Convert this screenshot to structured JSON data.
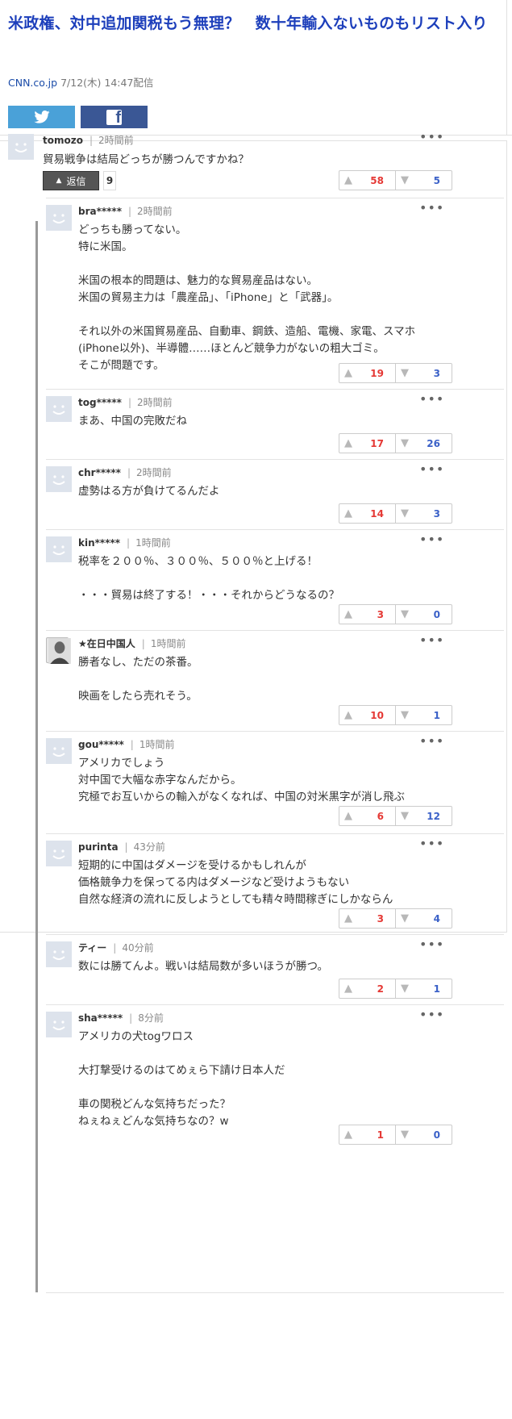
{
  "article": {
    "title": "米政権、対中追加関税もう無理？　数十年輸入ないものもリスト入り",
    "source": "CNN.co.jp",
    "date": "7/12(木) 14:47配信"
  },
  "share": {
    "twitter_icon": "twitter-bird-icon",
    "facebook_icon": "facebook-f-icon",
    "facebook_glyph": "f"
  },
  "top_comment": {
    "user": "tomozo",
    "time": "2時間前",
    "text": "貿易戦争は結局どっちが勝つんですかね？",
    "likes": "58",
    "dislikes": "5",
    "reply_label": "返信",
    "reply_count": "9",
    "more": "•••"
  },
  "replies": [
    {
      "user": "bra*****",
      "time": "2時間前",
      "text": "どっちも勝ってない。\n特に米国。\n\n米国の根本的問題は、魅力的な貿易産品はない。\n米国の貿易主力は「農産品」、「iPhone」と「武器」。\n\nそれ以外の米国貿易産品、自動車、鋼鉄、造船、電機、家電、スマホ(iPhone以外)、半導體……ほとんど競争力がないの粗大ゴミ。\nそこが問題です。",
      "likes": "19",
      "dislikes": "3"
    },
    {
      "user": "tog*****",
      "time": "2時間前",
      "text": "まあ、中国の完敗だね",
      "likes": "17",
      "dislikes": "26"
    },
    {
      "user": "chr*****",
      "time": "2時間前",
      "text": "虚勢はる方が負けてるんだよ",
      "likes": "14",
      "dislikes": "3"
    },
    {
      "user": "kin*****",
      "time": "1時間前",
      "text": "税率を２００％、３００％、５００％と上げる！\n\n・・・貿易は終了する！・・・それからどうなるの？",
      "likes": "3",
      "dislikes": "0"
    },
    {
      "user": "★在日中国人",
      "time": "1時間前",
      "text": "勝者なし、ただの茶番。\n\n映画をしたら売れそう。",
      "likes": "10",
      "dislikes": "1"
    },
    {
      "user": "gou*****",
      "time": "1時間前",
      "text": "アメリカでしょう\n対中国で大幅な赤字なんだから。\n究極でお互いからの輸入がなくなれば、中国の対米黒字が消し飛ぶ",
      "likes": "6",
      "dislikes": "12"
    },
    {
      "user": "purinta",
      "time": "43分前",
      "text": "短期的に中国はダメージを受けるかもしれんが\n価格競争力を保ってる内はダメージなど受けようもない\n自然な経済の流れに反しようとしても精々時間稼ぎにしかならん",
      "likes": "3",
      "dislikes": "4"
    },
    {
      "user": "ティー",
      "time": "40分前",
      "text": "数には勝てんよ。戦いは結局数が多いほうが勝つ。",
      "likes": "2",
      "dislikes": "1"
    },
    {
      "user": "sha*****",
      "time": "8分前",
      "text": "アメリカの犬togワロス\n\n大打撃受けるのはてめぇら下請け日本人だ\n\n車の関税どんな気持ちだった？\nねぇねぇどんな気持ちなの？w",
      "likes": "1",
      "dislikes": "0"
    }
  ],
  "icons": {
    "like": "thumbs-up-icon",
    "dislike": "thumbs-down-icon",
    "avatar": "default-avatar-icon",
    "more": "more-options-icon"
  },
  "colors": {
    "title": "#1d3fbb",
    "like": "#e53935",
    "dislike": "#3b61c8",
    "twitter": "#4aa1d8",
    "facebook": "#3a5795"
  }
}
